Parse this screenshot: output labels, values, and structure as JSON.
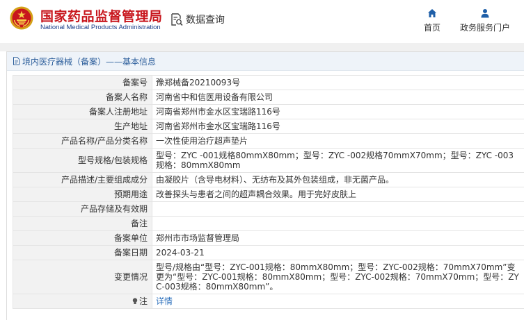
{
  "header": {
    "brand_cn": "国家药品监督管理局",
    "brand_en": "National Medical Products Administration",
    "search_label": "数据查询",
    "nav": [
      {
        "label": "首页",
        "icon": "home-icon"
      },
      {
        "label": "政务服务门户",
        "icon": "user-icon"
      }
    ]
  },
  "panel": {
    "title": "境内医疗器械（备案）——基本信息"
  },
  "record": {
    "rows": [
      {
        "key": "备案号",
        "value": "豫郑械备20210093号"
      },
      {
        "key": "备案人名称",
        "value": "河南省中和信医用设备有限公司"
      },
      {
        "key": "备案人注册地址",
        "value": "河南省郑州市金水区宝瑞路116号"
      },
      {
        "key": "生产地址",
        "value": "河南省郑州市金水区宝瑞路116号"
      },
      {
        "key": "产品名称/产品分类名称",
        "value": "一次性使用治疗超声垫片"
      },
      {
        "key": "型号规格/包装规格",
        "value": "型号：ZYC -001规格80mmX80mm；型号：ZYC -002规格70mmX70mm；型号：ZYC -003规格：80mmX80mm"
      },
      {
        "key": "产品描述/主要组成成分",
        "value": "由凝胶片（含导电材料）、无纺布及其外包装组成，非无菌产品。"
      },
      {
        "key": "预期用途",
        "value": "改善探头与患者之间的超声耦合效果。用于完好皮肤上"
      },
      {
        "key": "产品存储及有效期",
        "value": ""
      },
      {
        "key": "备注",
        "value": ""
      },
      {
        "key": "备案单位",
        "value": "郑州市市场监督管理局"
      },
      {
        "key": "备案日期",
        "value": "2024-03-21"
      },
      {
        "key": "变更情况",
        "value": "型号/规格由“型号：ZYC-001规格：80mmX80mm；型号：ZYC-002规格：70mmX70mm”变更为“型号：ZYC-001规格：80mmX80mm；型号：ZYC-002规格：70mmX70mm；型号：ZYC-003规格：80mmX80mm”。"
      }
    ],
    "note_key": "注",
    "note_link": "详情"
  },
  "colors": {
    "brand_red": "#c8161d",
    "brand_blue": "#1a3d8a",
    "panel_title": "#2d5f9c",
    "link": "#2a6ebb"
  }
}
